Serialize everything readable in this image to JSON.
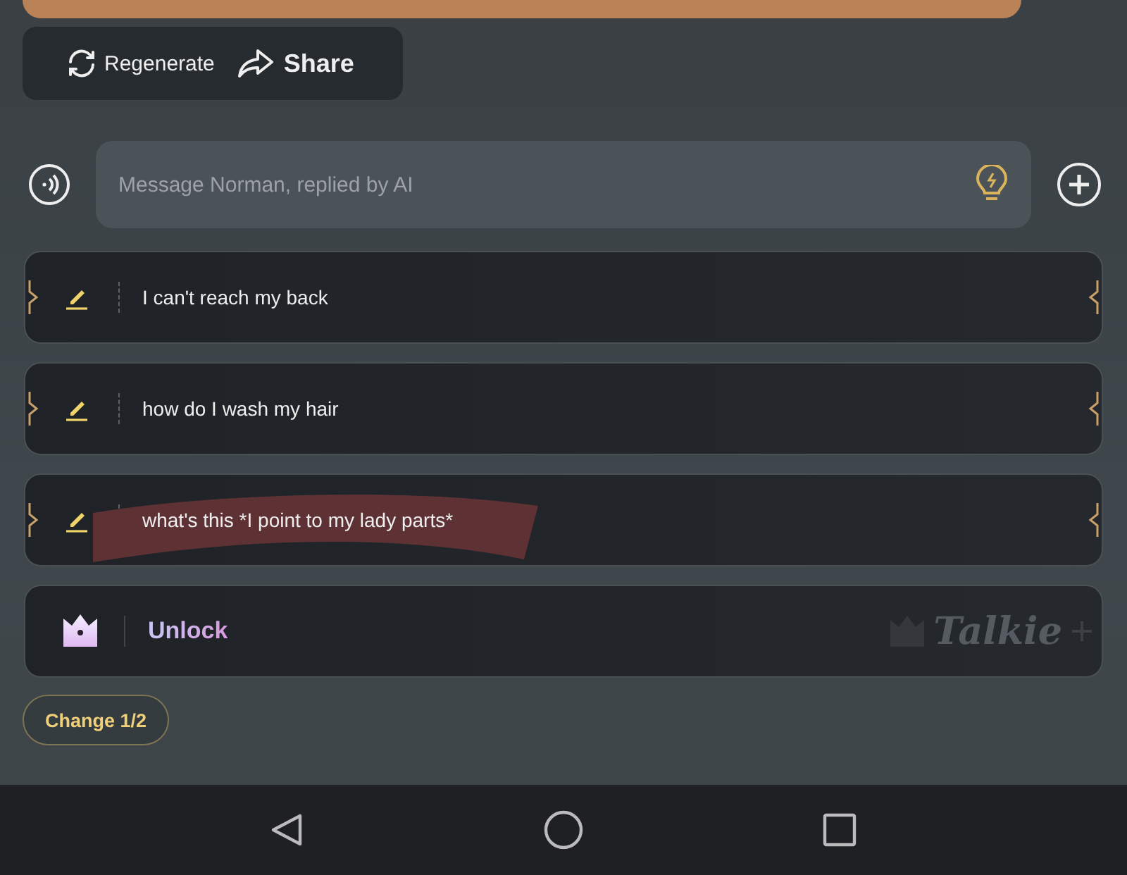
{
  "actions": [
    {
      "kind": "regenerate",
      "label": "Regenerate"
    },
    {
      "kind": "share",
      "label": "Share"
    }
  ],
  "composer": {
    "placeholder": "Message Norman, replied by AI"
  },
  "suggestions": [
    {
      "text": "I can't reach my back",
      "marked": false
    },
    {
      "text": "how do I wash my hair",
      "marked": false
    },
    {
      "text": "what's this *I point to my lady parts*",
      "marked": true
    }
  ],
  "unlock": {
    "label": "Unlock",
    "brand": "Talkie"
  },
  "change_button": "Change 1/2",
  "nav": [
    {
      "kind": "back"
    },
    {
      "kind": "home"
    },
    {
      "kind": "recents"
    }
  ]
}
